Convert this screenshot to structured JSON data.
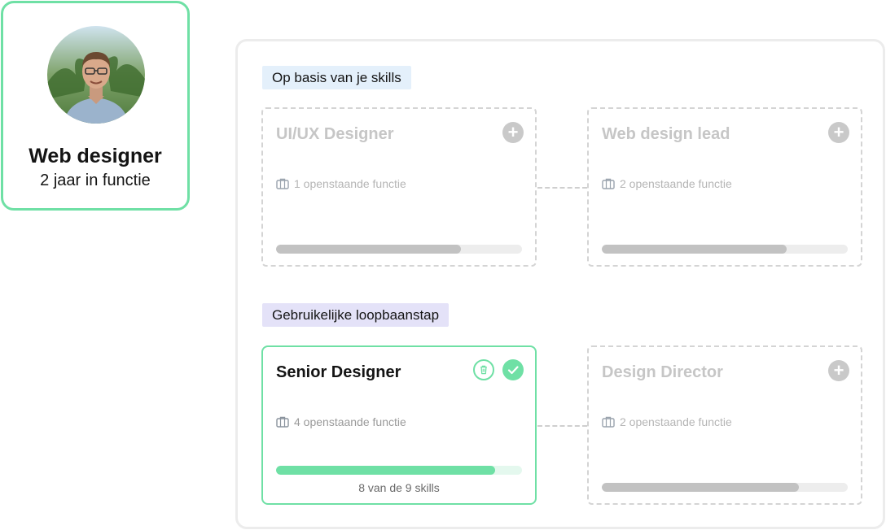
{
  "profile": {
    "title": "Web designer",
    "subtitle": "2 jaar in functie",
    "avatar_icon": "person-photo"
  },
  "sections": {
    "skills_label": "Op basis van je skills",
    "career_label": "Gebruikelijke loopbaanstap"
  },
  "cards": [
    {
      "title": "UI/UX Designer",
      "openings": "1 openstaande functie",
      "progress": 0.75,
      "state": "suggested"
    },
    {
      "title": "Web design lead",
      "openings": "2 openstaande functie",
      "progress": 0.75,
      "state": "suggested"
    },
    {
      "title": "Senior Designer",
      "openings": "4 openstaande functie",
      "progress": 0.89,
      "state": "selected",
      "skills_caption": "8 van de 9 skills"
    },
    {
      "title": "Design Director",
      "openings": "2 openstaande functie",
      "progress": 0.8,
      "state": "suggested"
    }
  ],
  "icons": {
    "add": "+",
    "briefcase": "briefcase-icon",
    "trash": "trash-icon",
    "check": "check-icon"
  },
  "colors": {
    "accent_green": "#6fe0a5",
    "skills_tag_bg": "#e4f0fb",
    "career_tag_bg": "#e4e2f8",
    "muted": "#c6c6c6"
  }
}
